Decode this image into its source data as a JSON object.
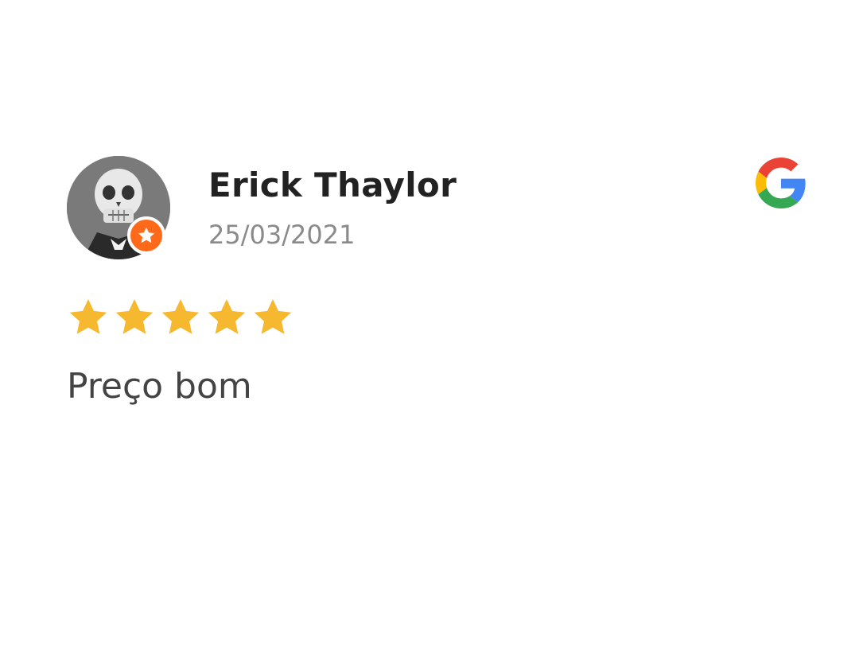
{
  "review": {
    "author_name": "Erick Thaylor",
    "date": "25/03/2021",
    "rating": 5,
    "rating_max": 5,
    "text": "Preço bom",
    "avatar_icon": "skull-avatar",
    "badge_icon": "star-badge-icon",
    "source_icon": "google-icon"
  },
  "colors": {
    "star": "#F5B82E",
    "badge": "#FF6A1A",
    "name": "#222222",
    "date": "#8A8A8A",
    "text": "#444444"
  }
}
